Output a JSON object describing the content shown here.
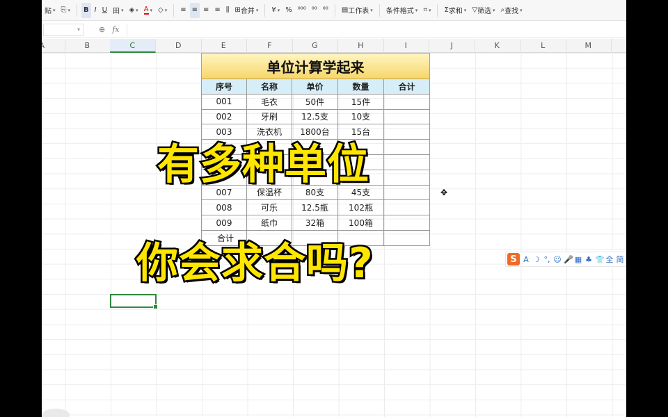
{
  "toolbar": {
    "items": [
      {
        "name": "paste",
        "label": "贴"
      },
      {
        "name": "format-painter",
        "label": "⎘"
      },
      {
        "name": "bold",
        "label": "B"
      },
      {
        "name": "italic",
        "label": "I"
      },
      {
        "name": "underline",
        "label": "U"
      },
      {
        "name": "borders",
        "label": "田"
      },
      {
        "name": "fill-color",
        "label": "◈"
      },
      {
        "name": "font-color",
        "label": "A"
      },
      {
        "name": "clear-format",
        "label": "◇"
      },
      {
        "name": "align-top",
        "label": "≡"
      },
      {
        "name": "align-middle",
        "label": "≡"
      },
      {
        "name": "align-bottom",
        "label": "≡"
      },
      {
        "name": "align-justify",
        "label": "≡"
      },
      {
        "name": "distribute",
        "label": "⫼"
      },
      {
        "name": "merge",
        "label": "合并"
      },
      {
        "name": "currency",
        "label": "¥"
      },
      {
        "name": "percent",
        "label": "%"
      },
      {
        "name": "thousands",
        "label": "⁰⁰⁰"
      },
      {
        "name": "increase-decimal",
        "label": "⁰⁰"
      },
      {
        "name": "decrease-decimal",
        "label": "⁰⁰"
      },
      {
        "name": "worksheet",
        "label": "工作表"
      },
      {
        "name": "conditional-format",
        "label": "条件格式"
      },
      {
        "name": "cell-format",
        "label": "⌗"
      },
      {
        "name": "sum",
        "label": "求和"
      },
      {
        "name": "filter",
        "label": "筛选"
      },
      {
        "name": "find",
        "label": "查找"
      }
    ]
  },
  "formula_bar": {
    "namebox": "▾",
    "zoom_icon": "⊕",
    "fx": "fx"
  },
  "columns": [
    "A",
    "B",
    "C",
    "D",
    "E",
    "F",
    "G",
    "H",
    "I",
    "J",
    "K",
    "L",
    "M"
  ],
  "selected_column": "C",
  "table": {
    "title": "单位计算学起来",
    "headers": [
      "序号",
      "名称",
      "单价",
      "数量",
      "合计"
    ],
    "rows": [
      [
        "001",
        "毛衣",
        "50件",
        "15件",
        ""
      ],
      [
        "002",
        "牙刷",
        "12.5支",
        "10支",
        ""
      ],
      [
        "003",
        "洗衣机",
        "1800台",
        "15台",
        ""
      ],
      [
        "",
        "",
        "",
        "",
        ""
      ],
      [
        "",
        "",
        "",
        "",
        ""
      ],
      [
        "",
        "",
        "",
        "",
        ""
      ],
      [
        "007",
        "保温杯",
        "80支",
        "45支",
        ""
      ],
      [
        "008",
        "可乐",
        "12.5瓶",
        "102瓶",
        ""
      ],
      [
        "009",
        "纸巾",
        "32箱",
        "100箱",
        ""
      ],
      [
        "合计",
        "",
        "",
        "",
        ""
      ]
    ]
  },
  "overlay": {
    "line1": "有多种单位",
    "line2": "你会求合吗?"
  },
  "ime": {
    "logo": "S",
    "icons": [
      "A",
      "☽",
      "°,",
      "☺",
      "🎤",
      "▦",
      "♣",
      "👕",
      "全",
      "简"
    ]
  }
}
